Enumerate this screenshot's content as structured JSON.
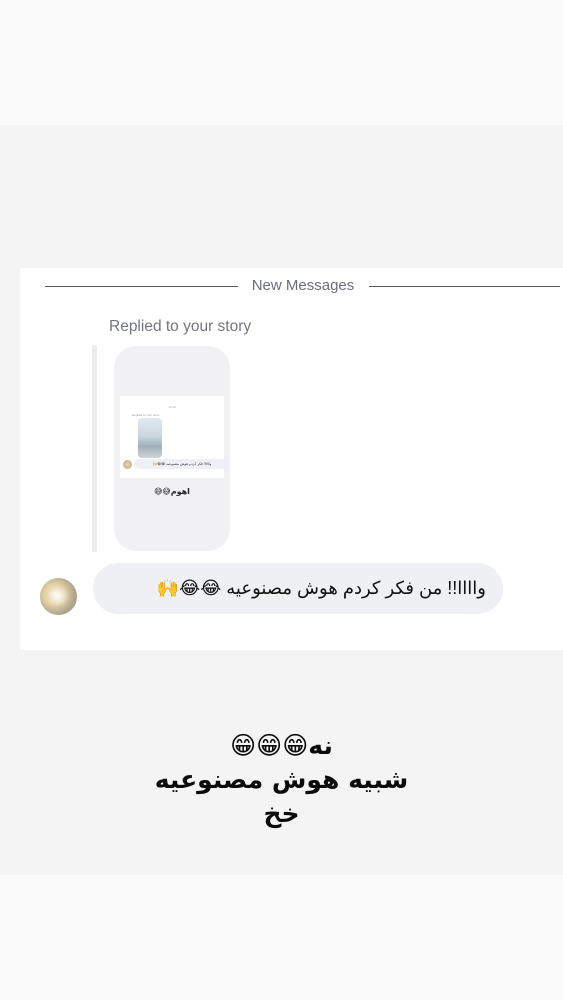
{
  "divider": {
    "label": "New Messages"
  },
  "reply": {
    "label": "Replied to your story",
    "thumbnail": {
      "header": "New Messages",
      "time": "12:44",
      "replied": "Replied to your story",
      "bubble_text": "واااا!! فکر کردم هوش مصنوعیه 😂😂🙌",
      "reply_text": "اهوم😅😅"
    }
  },
  "message": {
    "text": "واااا!! من فکر کردم هوش مصنوعیه 😂😂🙌"
  },
  "caption": {
    "line1": "نه😁😁😁",
    "line2": "شبیه هوش مصنوعیه",
    "line3": "خخ"
  }
}
